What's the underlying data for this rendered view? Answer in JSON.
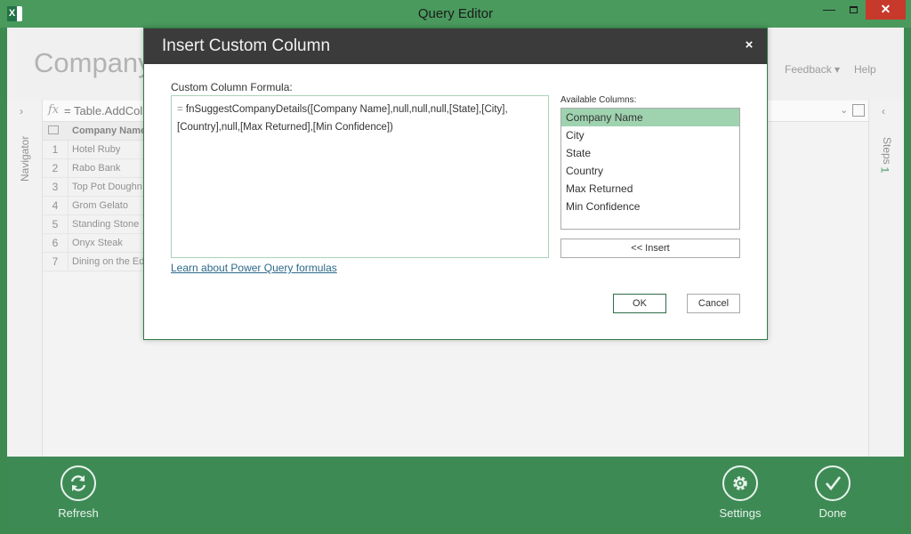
{
  "window": {
    "title": "Query Editor",
    "app_icon": "excel-icon",
    "close_symbol": "✕",
    "minimize_symbol": "—"
  },
  "ribbon": {
    "title": "Company",
    "feedback": "Feedback ▾",
    "help": "Help"
  },
  "navigator": {
    "label": "Navigator",
    "chevron": "›"
  },
  "steps": {
    "label": "Steps",
    "chevron": "‹",
    "count": "1"
  },
  "formula_bar": {
    "fx": "fx",
    "text": "= Table.AddCol",
    "expand_symbol": "⌄"
  },
  "grid": {
    "column_header": "Company Name",
    "rows": [
      {
        "num": "1",
        "value": "Hotel Ruby"
      },
      {
        "num": "2",
        "value": "Rabo Bank"
      },
      {
        "num": "3",
        "value": "Top Pot Doughn"
      },
      {
        "num": "4",
        "value": "Grom Gelato"
      },
      {
        "num": "5",
        "value": "Standing Stone"
      },
      {
        "num": "6",
        "value": "Onyx Steak"
      },
      {
        "num": "7",
        "value": "Dining on the Ed"
      }
    ]
  },
  "bottom_bar": {
    "refresh": "Refresh",
    "settings": "Settings",
    "done": "Done"
  },
  "dialog": {
    "title": "Insert Custom Column",
    "close_symbol": "×",
    "formula_label": "Custom Column Formula:",
    "formula_eq": "=",
    "formula_value": "fnSuggestCompanyDetails([Company Name],null,null,null,[State],[City],[Country],null,[Max Returned],[Min Confidence])",
    "learn_link": "Learn about Power Query formulas",
    "available_label": "Available Columns:",
    "available_columns": [
      "Company Name",
      "City",
      "State",
      "Country",
      "Max Returned",
      "Min Confidence"
    ],
    "selected_column": "Company Name",
    "insert_button": "<< Insert",
    "ok_button": "OK",
    "cancel_button": "Cancel"
  },
  "colors": {
    "accent_green": "#3e8a55",
    "dialog_header": "#3b3b3b",
    "selected_item": "#9fd3b0"
  }
}
